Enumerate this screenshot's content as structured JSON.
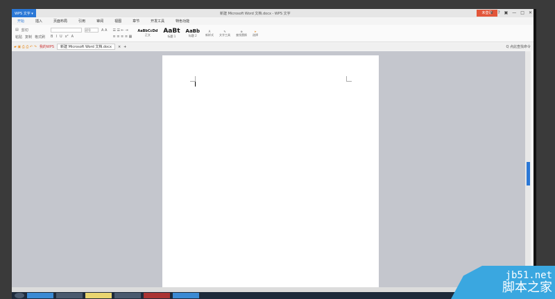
{
  "titlebar": {
    "app": "WPS 文字 ▾",
    "doc_title": "新建 Microsoft Word 文档.docx - WPS 文字",
    "login": "未登录",
    "controls": [
      "♛",
      "?",
      "▣",
      "—",
      "□",
      "✕"
    ]
  },
  "tabs": [
    "开始",
    "插入",
    "页面布局",
    "引用",
    "审阅",
    "视图",
    "章节",
    "开发工具",
    "特色功能"
  ],
  "ribbon": {
    "paste": "粘贴",
    "cut": "剪切",
    "copy": "复制",
    "format_painter": "格式刷",
    "font_size": "初号",
    "styles": [
      {
        "preview": "AaBbCcDd",
        "label": "正文"
      },
      {
        "preview": "AaBt",
        "label": "标题 1"
      },
      {
        "preview": "AaBb",
        "label": "标题 2"
      }
    ],
    "new_style": "新样式",
    "text_tools": "文字工具",
    "find_replace": "查找替换",
    "select": "选择"
  },
  "doctabs": {
    "my_wps": "我的WPS",
    "doc": "新建 Microsoft Word 文档.docx",
    "close": "×",
    "add": "+",
    "search": "Q 点此查找命令"
  },
  "watermark": {
    "site": "jb51.net",
    "name": "脚本之家"
  }
}
